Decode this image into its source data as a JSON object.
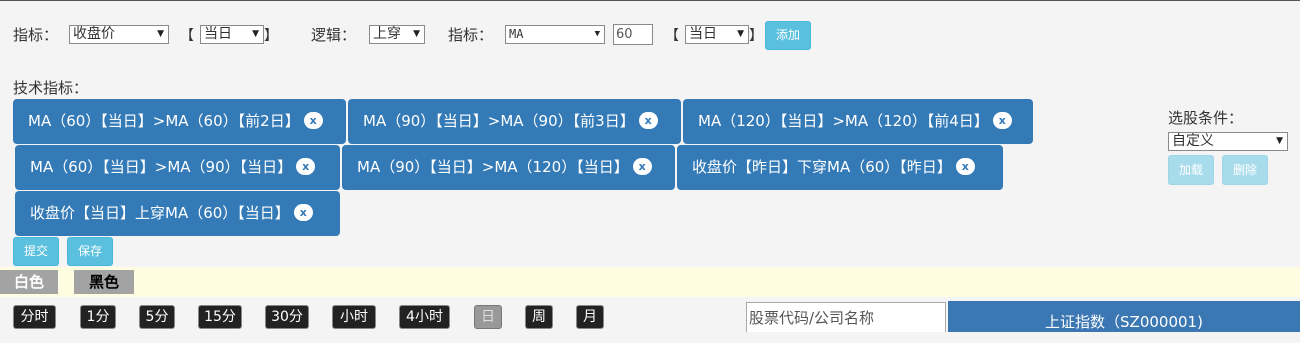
{
  "filter": {
    "indicator_label": "指标：",
    "indicator1_value": "收盘价",
    "day1_value": "当日",
    "logic_label": "逻辑：",
    "logic_value": "上穿",
    "indicator2_label": "指标：",
    "indicator2_value": "MA",
    "period_value": "60",
    "day2_value": "当日",
    "bracket_open": "【",
    "bracket_close": "】",
    "add_label": "添加"
  },
  "tech": {
    "label": "技术指标：",
    "chips": [
      "MA（60）【当日】>MA（60）【前2日】",
      "MA（90）【当日】>MA（90）【前3日】",
      "MA（120）【当日】>MA（120）【前4日】",
      "MA（60）【当日】>MA（90）【当日】",
      "MA（90）【当日】>MA（120）【当日】",
      "收盘价【昨日】下穿MA（60）【昨日】",
      "收盘价【当日】上穿MA（60）【当日】"
    ],
    "remove_glyph": "x"
  },
  "stock_condition": {
    "label": "选股条件：",
    "value": "自定义",
    "load_label": "加载",
    "delete_label": "删除"
  },
  "actions": {
    "submit_label": "提交",
    "save_label": "保存"
  },
  "theme": {
    "white_label": "白色",
    "black_label": "黑色"
  },
  "periods": [
    "分时",
    "1分",
    "5分",
    "15分",
    "30分",
    "小时",
    "4小时",
    "日",
    "周",
    "月"
  ],
  "active_period": "日",
  "search": {
    "placeholder": "股票代码/公司名称"
  },
  "index_title": "上证指数（SZ000001)",
  "colors": {
    "chip_bg": "#337ab7",
    "button_cyan": "#5bc0de",
    "theme_bar_bg": "#fffde1",
    "index_bar_bg": "#3a77b3"
  }
}
